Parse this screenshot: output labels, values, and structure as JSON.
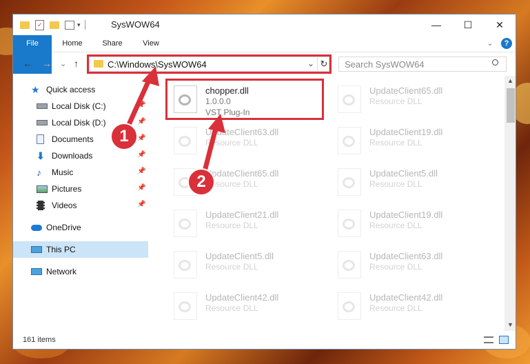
{
  "window": {
    "title": "SysWOW64",
    "minimize": "—",
    "maximize": "☐",
    "close": "✕"
  },
  "ribbon": {
    "tabs": [
      "File",
      "Home",
      "Share",
      "View"
    ],
    "expand": "⌄",
    "help": "?"
  },
  "nav": {
    "back": "←",
    "forward": "→",
    "recent": "⌄",
    "up": "↑",
    "address": "C:\\Windows\\SysWOW64",
    "refresh": "↻",
    "search_placeholder": "Search SysWOW64"
  },
  "sidebar": {
    "items": [
      {
        "label": "Quick access",
        "icon": "star-icon",
        "pinned": false
      },
      {
        "label": "Local Disk (C:)",
        "icon": "drive-icon",
        "pinned": true
      },
      {
        "label": "Local Disk (D:)",
        "icon": "drive-icon",
        "pinned": true
      },
      {
        "label": "Documents",
        "icon": "document-icon",
        "pinned": true
      },
      {
        "label": "Downloads",
        "icon": "download-icon",
        "pinned": true
      },
      {
        "label": "Music",
        "icon": "music-icon",
        "pinned": true
      },
      {
        "label": "Pictures",
        "icon": "pictures-icon",
        "pinned": true
      },
      {
        "label": "Videos",
        "icon": "video-icon",
        "pinned": true
      },
      {
        "label": "OneDrive",
        "icon": "cloud-icon",
        "pinned": false
      },
      {
        "label": "This PC",
        "icon": "computer-icon",
        "pinned": false
      },
      {
        "label": "Network",
        "icon": "network-icon",
        "pinned": false
      }
    ]
  },
  "files": {
    "highlighted": {
      "name": "chopper.dll",
      "version": "1.0.0.0",
      "type": "VST Plug-In"
    },
    "left_column": [
      {
        "name": "UpdateClient63.dll",
        "type": "Resource DLL"
      },
      {
        "name": "UpdateClient65.dll",
        "type": "Resource DLL"
      },
      {
        "name": "UpdateClient21.dll",
        "type": "Resource DLL"
      },
      {
        "name": "UpdateClient5.dll",
        "type": "Resource DLL"
      },
      {
        "name": "UpdateClient42.dll",
        "type": "Resource DLL"
      }
    ],
    "right_column": [
      {
        "name": "UpdateClient65.dll",
        "type": "Resource DLL"
      },
      {
        "name": "UpdateClient19.dll",
        "type": "Resource DLL"
      },
      {
        "name": "UpdateClient5.dll",
        "type": "Resource DLL"
      },
      {
        "name": "UpdateClient19.dll",
        "type": "Resource DLL"
      },
      {
        "name": "UpdateClient63.dll",
        "type": "Resource DLL"
      },
      {
        "name": "UpdateClient42.dll",
        "type": "Resource DLL"
      }
    ]
  },
  "status": {
    "item_count": "161 items"
  },
  "callouts": {
    "first": "1",
    "second": "2"
  },
  "colors": {
    "accent": "#1979ca",
    "highlight": "#d9303a",
    "selected": "#cce4f7"
  }
}
